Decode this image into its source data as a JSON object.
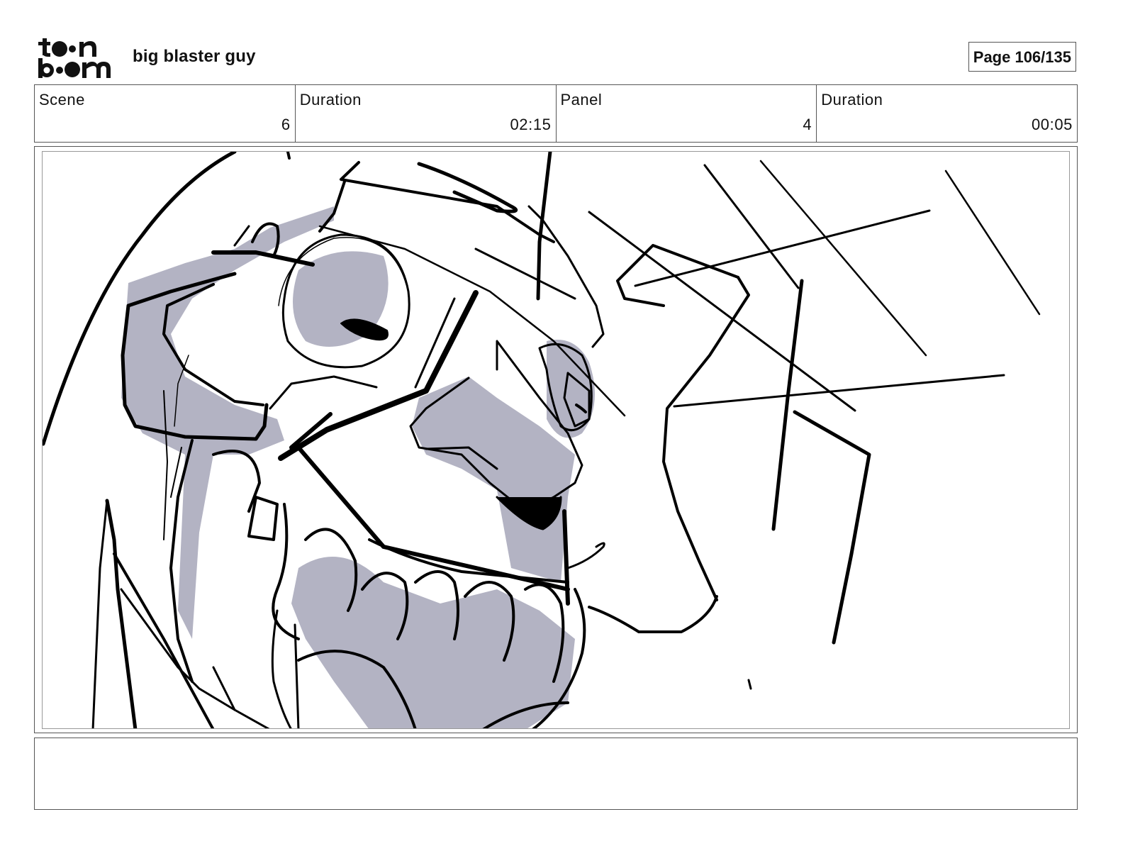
{
  "header": {
    "logo_text": "toon boom",
    "project_title": "big blaster guy",
    "page_label": "Page 106/135"
  },
  "info": [
    {
      "label": "Scene",
      "value": "6"
    },
    {
      "label": "Duration",
      "value": "02:15"
    },
    {
      "label": "Panel",
      "value": "4"
    },
    {
      "label": "Duration",
      "value": "00:05"
    }
  ],
  "panel": {
    "sketch_fill_color": "#b3b3c3",
    "line_color": "#000000"
  },
  "notes": {
    "text": ""
  }
}
